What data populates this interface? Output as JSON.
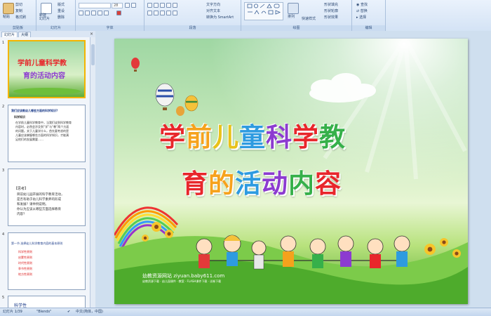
{
  "ribbon": {
    "groups": [
      {
        "name": "clipboard",
        "label": "剪贴板"
      },
      {
        "name": "slides",
        "label": "幻灯片"
      },
      {
        "name": "font",
        "label": "字体"
      },
      {
        "name": "paragraph",
        "label": "段落"
      },
      {
        "name": "drawing",
        "label": "绘图"
      },
      {
        "name": "editing",
        "label": "编辑"
      }
    ],
    "paste_label": "粘贴",
    "cut_label": "剪切",
    "copy_label": "复制",
    "format_label": "格式刷",
    "new_slide_label": "新建\n幻灯片",
    "layout_label": "版式",
    "reset_label": "重设",
    "delete_label": "删除",
    "font_size": "28",
    "text_direction_label": "文字方向",
    "align_text_label": "对齐文本",
    "smartart_label": "转换为 SmartArt",
    "arrange_label": "排列",
    "quick_styles_label": "快速样式",
    "shape_fill_label": "形状填充",
    "shape_outline_label": "形状轮廓",
    "shape_effects_label": "形状效果",
    "find_label": "查找",
    "replace_label": "替换",
    "select_label": "选择"
  },
  "pane": {
    "tab_slides": "幻灯片",
    "tab_outline": "大纲",
    "close": "×",
    "thumbs": [
      {
        "num": "1",
        "title1": "学前儿童科学教",
        "title2": "育的活动内容"
      },
      {
        "num": "2",
        "heading": "我们应该教幼儿哪些方面的科学知识?",
        "sub": "科学知识",
        "body": [
          "在学前儿童科学教育中，当我们谈到科学教育",
          "内容时，必然会涉及到“学”与“教”两个方面",
          "的问题。关于儿童学什么，首先要考虑的是",
          "儿童应该掌握哪些方面的科学知识，才能满",
          "足他们的发展需要……"
        ]
      },
      {
        "num": "3",
        "tag": "【思考】",
        "body": [
          "目前幼儿园开展的科学教育活动，",
          "是否有助于幼儿科学素养的形成",
          "和发展？请举例说明。",
          "你认为应该从哪些方面选择教育",
          "内容？"
        ]
      },
      {
        "num": "4",
        "heading": "第一节 选择幼儿科学教育内容的基本原则",
        "items": [
          "科学性原则",
          "启蒙性原则",
          "时代性原则",
          "季节性原则",
          "地方性原则"
        ]
      },
      {
        "num": "5",
        "text": "科学性"
      }
    ]
  },
  "slide": {
    "title_line1": "学前儿童科学教",
    "title_line2": "育的活动内容",
    "line1_colors": [
      "#e8262b",
      "#f6a21c",
      "#e8c21a",
      "#2e9be0",
      "#8c3bd0",
      "#e8262b",
      "#36b04a"
    ],
    "line2_colors": [
      "#e8262b",
      "#f6a21c",
      "#2e9be0",
      "#8c3bd0",
      "#36b04a",
      "#e8262b"
    ],
    "watermark": "幼教资源网站  ziyuan.baby611.com",
    "watermark_small": "幼教资源下载 · 幼儿园课件 · 教案 · FLASH课件下载 · 试卷下载"
  },
  "status": {
    "slide_pos": "幻灯片 1/39",
    "theme": "\"Blends\"",
    "language": "中文(简体，中国)"
  },
  "colors": {
    "ribbon_bg": "#dbe7f6",
    "accent": "#f4b400",
    "slide_green": "#4fa82e"
  }
}
